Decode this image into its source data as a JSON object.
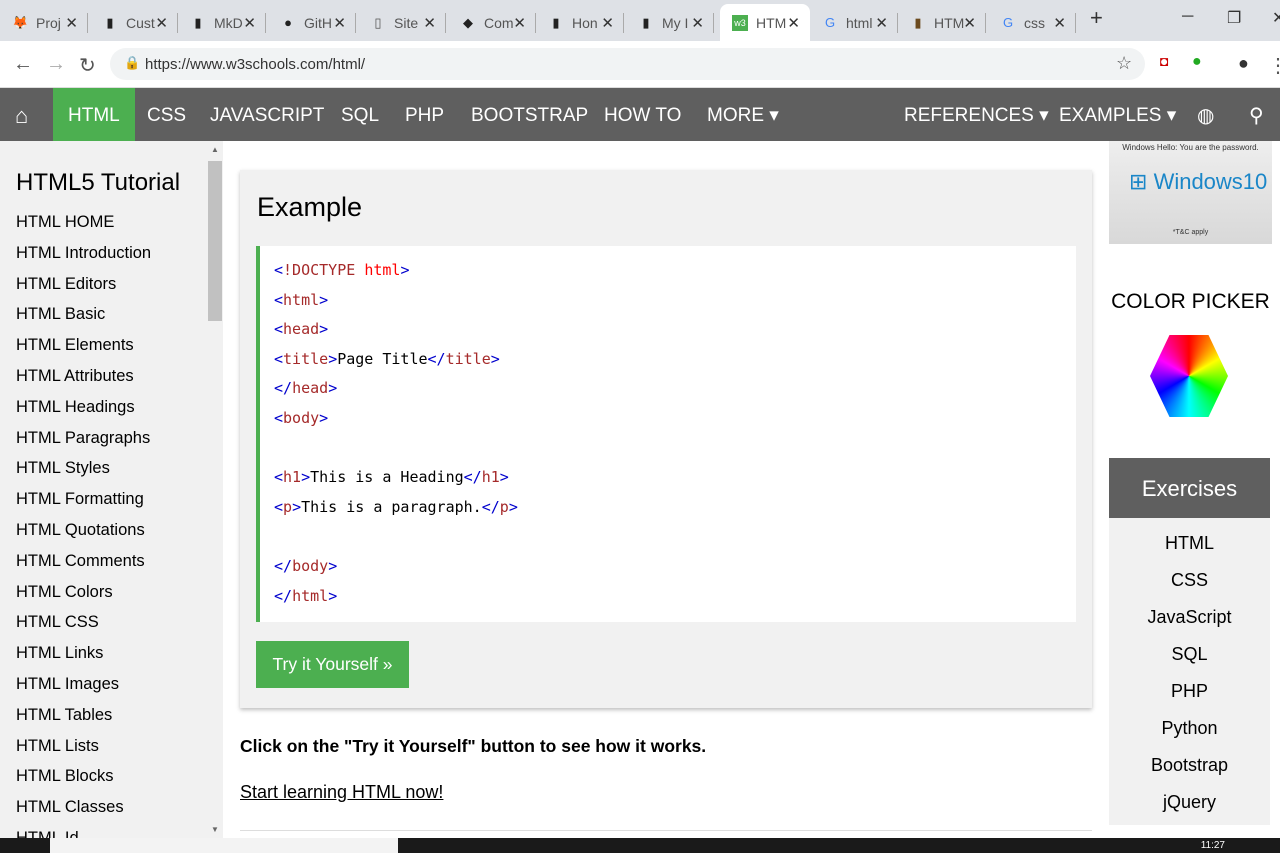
{
  "browser": {
    "tabs": [
      {
        "title": "Proj",
        "icon": "gitlab-icon"
      },
      {
        "title": "Cust",
        "icon": "book-icon"
      },
      {
        "title": "MkD",
        "icon": "book-icon"
      },
      {
        "title": "GitH",
        "icon": "github-icon"
      },
      {
        "title": "Site",
        "icon": "document-icon"
      },
      {
        "title": "Com",
        "icon": "graduation-cap-icon"
      },
      {
        "title": "Hon",
        "icon": "book-icon"
      },
      {
        "title": "My I",
        "icon": "book-icon"
      },
      {
        "title": "HTM",
        "icon": "w3schools-icon",
        "active": true
      },
      {
        "title": "html",
        "icon": "google-icon"
      },
      {
        "title": "HTM",
        "icon": "image-icon"
      },
      {
        "title": "css",
        "icon": "google-icon"
      }
    ],
    "url": "https://www.w3schools.com/html/"
  },
  "nav": {
    "items": [
      "HTML",
      "CSS",
      "JAVASCRIPT",
      "SQL",
      "PHP",
      "BOOTSTRAP",
      "HOW TO",
      "MORE ▾"
    ],
    "right": [
      "REFERENCES ▾",
      "EXAMPLES ▾"
    ]
  },
  "sidebar": {
    "title": "HTML5 Tutorial",
    "items": [
      "HTML HOME",
      "HTML Introduction",
      "HTML Editors",
      "HTML Basic",
      "HTML Elements",
      "HTML Attributes",
      "HTML Headings",
      "HTML Paragraphs",
      "HTML Styles",
      "HTML Formatting",
      "HTML Quotations",
      "HTML Comments",
      "HTML Colors",
      "HTML CSS",
      "HTML Links",
      "HTML Images",
      "HTML Tables",
      "HTML Lists",
      "HTML Blocks",
      "HTML Classes",
      "HTML Id"
    ]
  },
  "example": {
    "title": "Example",
    "code": [
      [
        [
          "br",
          "<"
        ],
        [
          "tn",
          "!DOCTYPE "
        ],
        [
          "dt",
          "html"
        ],
        [
          "br",
          ">"
        ]
      ],
      [
        [
          "br",
          "<"
        ],
        [
          "tn",
          "html"
        ],
        [
          "br",
          ">"
        ]
      ],
      [
        [
          "br",
          "<"
        ],
        [
          "tn",
          "head"
        ],
        [
          "br",
          ">"
        ]
      ],
      [
        [
          "br",
          "<"
        ],
        [
          "tn",
          "title"
        ],
        [
          "br",
          ">"
        ],
        [
          "tx",
          "Page Title"
        ],
        [
          "br",
          "</"
        ],
        [
          "tn",
          "title"
        ],
        [
          "br",
          ">"
        ]
      ],
      [
        [
          "br",
          "</"
        ],
        [
          "tn",
          "head"
        ],
        [
          "br",
          ">"
        ]
      ],
      [
        [
          "br",
          "<"
        ],
        [
          "tn",
          "body"
        ],
        [
          "br",
          ">"
        ]
      ],
      [],
      [
        [
          "br",
          "<"
        ],
        [
          "tn",
          "h1"
        ],
        [
          "br",
          ">"
        ],
        [
          "tx",
          "This is a Heading"
        ],
        [
          "br",
          "</"
        ],
        [
          "tn",
          "h1"
        ],
        [
          "br",
          ">"
        ]
      ],
      [
        [
          "br",
          "<"
        ],
        [
          "tn",
          "p"
        ],
        [
          "br",
          ">"
        ],
        [
          "tx",
          "This is a paragraph."
        ],
        [
          "br",
          "</"
        ],
        [
          "tn",
          "p"
        ],
        [
          "br",
          ">"
        ]
      ],
      [],
      [
        [
          "br",
          "</"
        ],
        [
          "tn",
          "body"
        ],
        [
          "br",
          ">"
        ]
      ],
      [
        [
          "br",
          "</"
        ],
        [
          "tn",
          "html"
        ],
        [
          "br",
          ">"
        ]
      ]
    ],
    "button": "Try it Yourself »"
  },
  "main": {
    "info": "Click on the \"Try it Yourself\" button to see how it works.",
    "link": "Start learning HTML now!"
  },
  "ad": {
    "line1": "Windows Hello: You are the password.",
    "brand": "Windows10",
    "line2": "*T&C apply"
  },
  "right": {
    "color_picker": "COLOR PICKER",
    "exercises_title": "Exercises",
    "exercises": [
      "HTML",
      "CSS",
      "JavaScript",
      "SQL",
      "PHP",
      "Python",
      "Bootstrap",
      "jQuery"
    ]
  },
  "taskbar": {
    "clock": "11:27"
  },
  "colors": {
    "accent": "#4caf50",
    "nav": "#5f5f5f"
  }
}
